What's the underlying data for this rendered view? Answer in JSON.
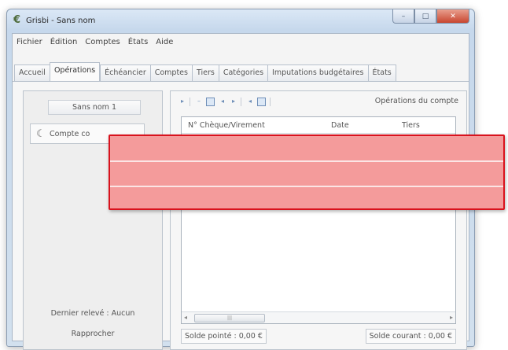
{
  "window": {
    "title": "Grisbi - Sans nom",
    "controls": {
      "minimize": "–",
      "maximize": "□",
      "close": "✕"
    }
  },
  "menu": [
    "Fichier",
    "Édition",
    "Comptes",
    "États",
    "Aide"
  ],
  "tabs": [
    {
      "label": "Accueil",
      "active": false
    },
    {
      "label": "Opérations",
      "active": true
    },
    {
      "label": "Échéancier",
      "active": false
    },
    {
      "label": "Comptes",
      "active": false
    },
    {
      "label": "Tiers",
      "active": false
    },
    {
      "label": "Catégories",
      "active": false
    },
    {
      "label": "Imputations budgétaires",
      "active": false
    },
    {
      "label": "États",
      "active": false
    }
  ],
  "left_panel": {
    "account_file": "Sans nom 1",
    "account_button": "Compte co",
    "dernier_releve": "Dernier relevé : Aucun",
    "rapprocher": "Rapprocher"
  },
  "right_panel": {
    "title": "Opérations du compte",
    "columns": [
      "N° Chèque/Virement",
      "Date",
      "Tiers"
    ],
    "solde_pointe": "Solde pointé : 0,00 €",
    "solde_courant": "Solde courant : 0,00 €"
  },
  "colors": {
    "overlay_fill": "#f49b9b",
    "overlay_border": "#d9121d"
  }
}
